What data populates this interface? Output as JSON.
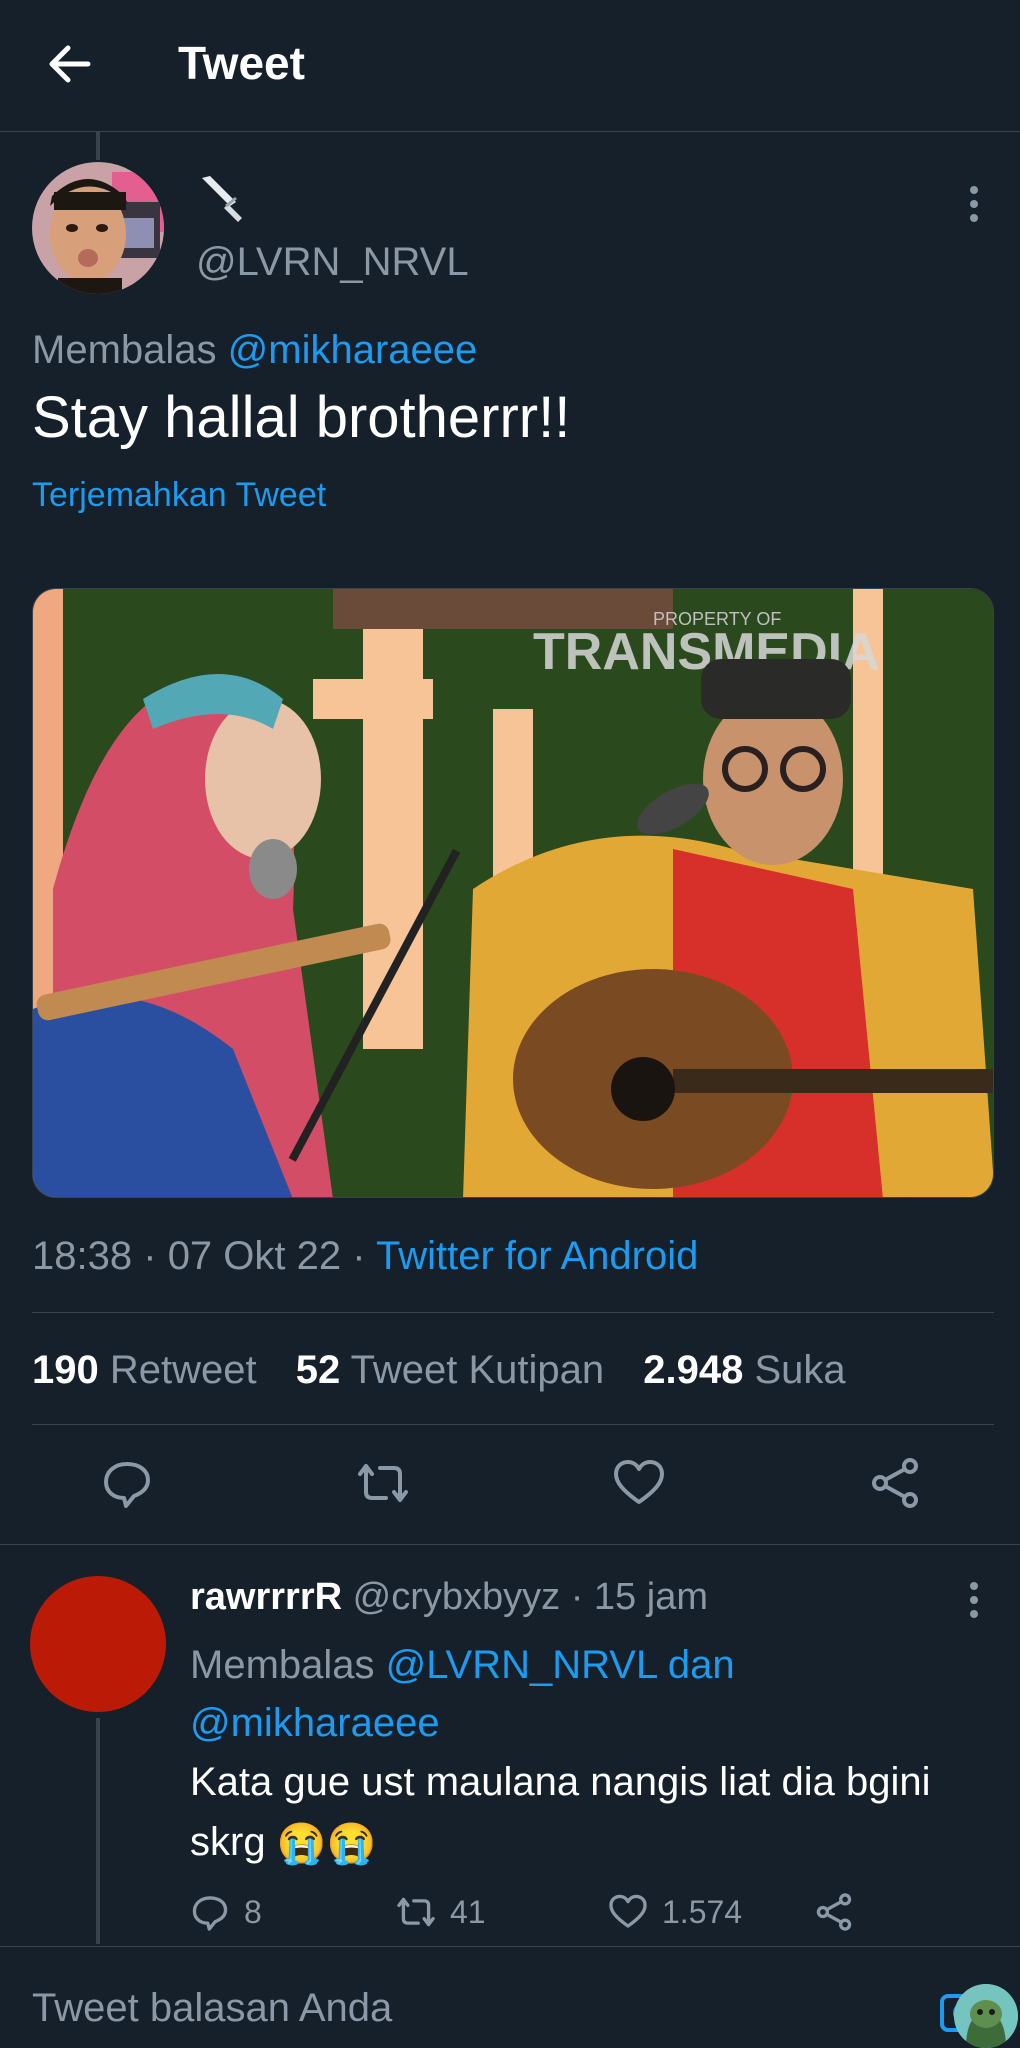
{
  "header": {
    "title": "Tweet",
    "back_icon": "arrow-left-icon"
  },
  "tweet": {
    "display_name_icon": "knife-icon",
    "handle": "@LVRN_NRVL",
    "reply_prefix": "Membalas",
    "reply_to": "@mikharaeee",
    "text": "Stay hallal brotherrr!!",
    "translate_label": "Terjemahkan Tweet",
    "media_watermark": {
      "top": "PROPERTY OF",
      "main": "TRANSMEDIA"
    },
    "time": "18:38",
    "date": "07 Okt 22",
    "separator": "·",
    "source": "Twitter for Android",
    "stats": {
      "retweets": "190",
      "retweets_label": "Retweet",
      "quotes": "52",
      "quotes_label": "Tweet Kutipan",
      "likes": "2.948",
      "likes_label": "Suka"
    }
  },
  "reply": {
    "name": "rawrrrrR",
    "handle": "@crybxbyyz",
    "time": "15 jam",
    "reply_prefix": "Membalas",
    "reply_to_1": "@LVRN_NRVL",
    "reply_joiner": "dan",
    "reply_to_2": "@mikharaeee",
    "text": "Kata gue ust maulana nangis liat dia bgini skrg",
    "emoji": "😭😭",
    "counts": {
      "replies": "8",
      "retweets": "41",
      "likes": "1.574"
    }
  },
  "composer": {
    "placeholder": "Tweet balasan Anda"
  },
  "colors": {
    "background": "#15202b",
    "accent": "#1d9bf0",
    "muted": "#8b98a5",
    "border": "#38444d"
  }
}
